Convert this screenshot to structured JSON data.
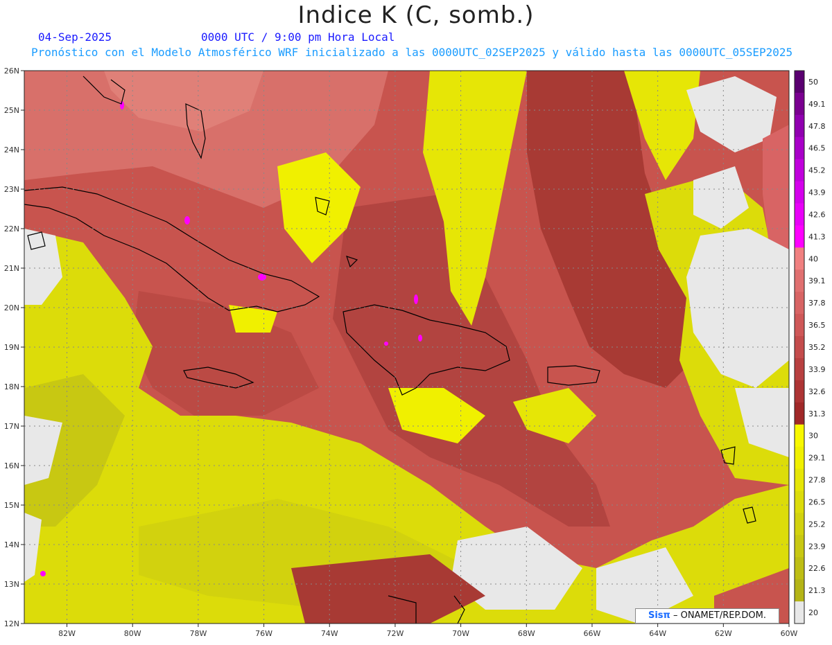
{
  "header": {
    "title": "Indice K (C, somb.)",
    "date": "04-Sep-2025",
    "time": "0000 UTC / 9:00 pm Hora Local",
    "model_line": "Pronóstico con el Modelo Atmosférico WRF inicializado a las 0000UTC_02SEP2025 y válido hasta las  0000UTC_05SEP2025"
  },
  "map": {
    "lat_labels": [
      "26N",
      "25N",
      "24N",
      "23N",
      "22N",
      "21N",
      "20N",
      "19N",
      "18N",
      "17N",
      "16N",
      "15N",
      "14N",
      "13N",
      "12N"
    ],
    "lat_values": [
      26,
      25,
      24,
      23,
      22,
      21,
      20,
      19,
      18,
      17,
      16,
      15,
      14,
      13,
      12
    ],
    "lon_labels": [
      "82W",
      "80W",
      "78W",
      "76W",
      "74W",
      "72W",
      "70W",
      "68W",
      "66W",
      "64W",
      "62W",
      "60W"
    ],
    "lon_values": [
      -82,
      -80,
      -78,
      -76,
      -74,
      -72,
      -70,
      -68,
      -66,
      -64,
      -62,
      -60
    ],
    "lat_range": [
      12,
      26
    ],
    "lon_range": [
      -83.3,
      -60
    ]
  },
  "legend": {
    "labels": [
      "50",
      "49.1",
      "47.8",
      "46.5",
      "45.2",
      "43.9",
      "42.6",
      "41.3",
      "40",
      "39.1",
      "37.8",
      "36.5",
      "35.2",
      "33.9",
      "32.6",
      "31.3",
      "30",
      "29.1",
      "27.8",
      "26.5",
      "25.2",
      "23.9",
      "22.6",
      "21.3",
      "20"
    ],
    "colors": [
      "#5a0070",
      "#7a0090",
      "#9000b0",
      "#a800c8",
      "#c000dc",
      "#d400ec",
      "#e800f8",
      "#ff00ff",
      "#f08080",
      "#e07070",
      "#d86464",
      "#cf5858",
      "#c44c4c",
      "#b84040",
      "#ad3434",
      "#a02828",
      "#f8f800",
      "#f0f000",
      "#e6e606",
      "#dcdc0a",
      "#d2d20e",
      "#c8c812",
      "#bebe14",
      "#b4b416",
      "#e8e8e8"
    ]
  },
  "credit": {
    "brand": "Sisπ",
    "text": "– ONAMET/REP.DOM."
  }
}
